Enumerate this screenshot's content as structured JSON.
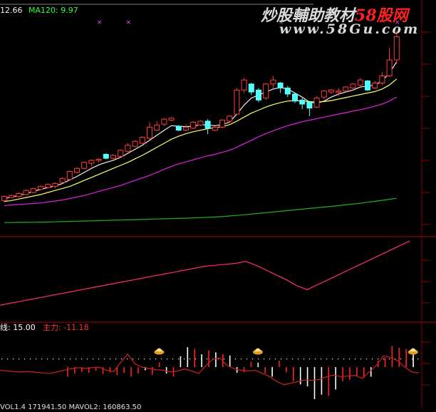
{
  "colors": {
    "background": "#000000",
    "grid": "#8b0000",
    "candle_up": "#ff3b3b",
    "candle_down": "#54ffff",
    "ma_white": "#f0f0f0",
    "ma_yellow": "#ffff66",
    "ma_magenta": "#e020e0",
    "ma_green": "#20b020",
    "indicator_line": "#ff3060",
    "volume_up": "#ff2020",
    "volume_down": "#ffffff",
    "ma120_label": "#30ff30",
    "main_force_label": "#ff3030"
  },
  "header": {
    "ma_partial_value": "12.66",
    "ma120_label": "MA120: 9.97"
  },
  "watermark": {
    "brand_prefix": "炒股輔助教材",
    "brand_highlight": "58股网",
    "url": "www.58Gu.com"
  },
  "lower_panel": {
    "line_label": "线: 15.00",
    "main_force_label": "主力: -11.18"
  },
  "footer": {
    "partial_text": "VOL1.4 171941.50  MAVOL2: 160863.50"
  },
  "chart_data": [
    {
      "type": "candlestick",
      "title": "",
      "candles": [
        [
          5.6,
          6.0,
          5.4,
          6.1
        ],
        [
          5.9,
          6.1,
          5.8,
          6.2
        ],
        [
          6.0,
          6.3,
          5.9,
          6.4
        ],
        [
          6.2,
          6.6,
          6.1,
          6.7
        ],
        [
          6.4,
          6.8,
          6.3,
          6.9
        ],
        [
          6.7,
          7.0,
          6.6,
          7.1
        ],
        [
          6.9,
          7.2,
          6.8,
          7.3
        ],
        [
          7.0,
          7.3,
          6.8,
          7.4
        ],
        [
          7.4,
          7.8,
          7.3,
          7.9
        ],
        [
          7.7,
          8.5,
          7.6,
          8.6
        ],
        [
          8.4,
          8.8,
          8.3,
          8.9
        ],
        [
          8.8,
          9.4,
          8.7,
          9.5
        ],
        [
          9.3,
          9.6,
          9.0,
          9.7
        ],
        [
          9.6,
          9.7,
          9.4,
          9.8
        ],
        [
          10.2,
          9.8,
          9.7,
          10.3
        ],
        [
          9.8,
          10.1,
          9.7,
          10.2
        ],
        [
          10.0,
          10.6,
          9.9,
          10.7
        ],
        [
          10.5,
          11.1,
          10.4,
          11.3
        ],
        [
          11.0,
          11.5,
          10.9,
          11.6
        ],
        [
          11.3,
          11.9,
          11.2,
          12.0
        ],
        [
          11.8,
          12.9,
          11.7,
          13.4
        ],
        [
          12.6,
          13.1,
          12.5,
          13.5
        ],
        [
          13.2,
          13.7,
          13.0,
          13.8
        ],
        [
          13.6,
          13.8,
          13.5,
          13.9
        ],
        [
          13.0,
          12.6,
          12.5,
          13.1
        ],
        [
          12.6,
          12.9,
          12.5,
          13.2
        ],
        [
          12.8,
          13.4,
          12.7,
          13.5
        ],
        [
          13.1,
          13.5,
          13.0,
          13.6
        ],
        [
          13.5,
          12.8,
          12.2,
          13.7
        ],
        [
          12.6,
          12.9,
          12.5,
          13.0
        ],
        [
          12.9,
          13.6,
          12.8,
          13.7
        ],
        [
          13.5,
          14.0,
          13.3,
          14.1
        ],
        [
          14.2,
          16.6,
          14.1,
          16.8
        ],
        [
          16.6,
          17.6,
          16.3,
          17.8
        ],
        [
          17.2,
          16.4,
          16.1,
          17.3
        ],
        [
          16.6,
          15.6,
          15.4,
          16.8
        ],
        [
          15.8,
          17.2,
          15.6,
          17.3
        ],
        [
          17.2,
          17.6,
          16.8,
          18.0
        ],
        [
          17.3,
          16.8,
          16.3,
          17.4
        ],
        [
          16.8,
          16.2,
          15.9,
          17.0
        ],
        [
          16.2,
          15.5,
          15.3,
          16.3
        ],
        [
          15.6,
          15.2,
          14.7,
          15.8
        ],
        [
          15.4,
          14.8,
          14.0,
          15.5
        ],
        [
          14.9,
          15.8,
          14.8,
          16.0
        ],
        [
          15.9,
          16.5,
          15.7,
          16.6
        ],
        [
          16.4,
          16.6,
          16.2,
          16.7
        ],
        [
          16.4,
          16.5,
          16.0,
          16.8
        ],
        [
          16.5,
          16.9,
          16.4,
          17.0
        ],
        [
          16.8,
          17.2,
          16.6,
          17.3
        ],
        [
          17.1,
          17.6,
          16.9,
          17.8
        ],
        [
          17.5,
          16.6,
          16.5,
          17.6
        ],
        [
          16.8,
          17.3,
          16.7,
          17.5
        ],
        [
          17.3,
          18.0,
          17.1,
          18.4
        ],
        [
          18.0,
          19.6,
          17.9,
          20.8
        ],
        [
          19.6,
          21.9,
          19.2,
          22.5
        ]
      ],
      "moving_averages": [
        {
          "name": "",
          "color_key": "ma_white",
          "values": [
            5.8,
            5.95,
            6.1,
            6.3,
            6.5,
            6.7,
            6.9,
            7.05,
            7.3,
            7.65,
            8.0,
            8.4,
            8.8,
            9.15,
            9.4,
            9.6,
            9.9,
            10.3,
            10.7,
            11.1,
            11.6,
            12.1,
            12.6,
            13.05,
            13.0,
            12.95,
            13.0,
            13.15,
            13.1,
            13.05,
            13.15,
            13.4,
            14.2,
            15.1,
            15.8,
            16.1,
            16.4,
            16.7,
            16.85,
            16.7,
            16.3,
            15.9,
            15.4,
            15.3,
            15.5,
            15.9,
            16.2,
            16.4,
            16.6,
            16.9,
            17.0,
            17.1,
            17.5,
            18.3,
            19.4
          ]
        },
        {
          "name": "",
          "color_key": "ma_yellow",
          "values": [
            5.5,
            5.6,
            5.75,
            5.9,
            6.05,
            6.2,
            6.4,
            6.6,
            6.8,
            7.0,
            7.3,
            7.6,
            7.9,
            8.2,
            8.5,
            8.8,
            9.1,
            9.4,
            9.75,
            10.1,
            10.5,
            10.9,
            11.3,
            11.7,
            12.0,
            12.25,
            12.45,
            12.6,
            12.75,
            12.85,
            12.95,
            13.15,
            13.5,
            13.9,
            14.3,
            14.6,
            14.9,
            15.15,
            15.35,
            15.5,
            15.55,
            15.5,
            15.45,
            15.4,
            15.45,
            15.55,
            15.7,
            15.85,
            16.0,
            16.15,
            16.3,
            16.45,
            16.7,
            17.1,
            17.7
          ]
        },
        {
          "name": "",
          "color_key": "ma_magenta",
          "values": [
            5.1,
            5.15,
            5.2,
            5.25,
            5.3,
            5.35,
            5.45,
            5.55,
            5.65,
            5.8,
            5.95,
            6.1,
            6.3,
            6.5,
            6.7,
            6.9,
            7.1,
            7.35,
            7.6,
            7.85,
            8.1,
            8.4,
            8.7,
            9.0,
            9.25,
            9.45,
            9.65,
            9.85,
            10.05,
            10.2,
            10.4,
            10.6,
            10.9,
            11.25,
            11.6,
            11.95,
            12.25,
            12.55,
            12.8,
            13.05,
            13.25,
            13.45,
            13.6,
            13.75,
            13.9,
            14.05,
            14.2,
            14.35,
            14.5,
            14.65,
            14.8,
            15.0,
            15.2,
            15.5,
            15.9
          ]
        },
        {
          "name": "MA120",
          "color_key": "ma_green",
          "values": [
            3.4,
            3.41,
            3.42,
            3.43,
            3.44,
            3.45,
            3.46,
            3.48,
            3.5,
            3.52,
            3.54,
            3.56,
            3.58,
            3.6,
            3.62,
            3.64,
            3.66,
            3.68,
            3.7,
            3.72,
            3.74,
            3.76,
            3.78,
            3.8,
            3.82,
            3.84,
            3.87,
            3.9,
            3.93,
            3.96,
            4.0,
            4.06,
            4.12,
            4.18,
            4.25,
            4.32,
            4.39,
            4.46,
            4.53,
            4.6,
            4.67,
            4.74,
            4.81,
            4.88,
            4.95,
            5.02,
            5.09,
            5.17,
            5.25,
            5.33,
            5.42,
            5.52,
            5.62,
            5.72,
            5.82
          ]
        }
      ],
      "top_markers": [
        13,
        17,
        38,
        54
      ]
    },
    {
      "type": "line",
      "title": "",
      "values": [
        0.1,
        0.14,
        0.18,
        0.22,
        0.26,
        0.3,
        0.34,
        0.38,
        0.42,
        0.46,
        0.5,
        0.54,
        0.58,
        0.62,
        0.66,
        0.7,
        0.74,
        0.78,
        0.82,
        0.86,
        0.9,
        0.92,
        0.94,
        0.96,
        1.0,
        0.92,
        0.82,
        0.72,
        0.62,
        0.5,
        0.42,
        0.52,
        0.62,
        0.72,
        0.82,
        0.92,
        1.02,
        1.12,
        1.22,
        1.32,
        1.42
      ]
    },
    {
      "type": "bar",
      "title": "",
      "bars": [
        [
          -0.3,
          1
        ],
        [
          -0.2,
          1
        ],
        [
          -0.15,
          1
        ],
        [
          -0.18,
          1
        ],
        [
          -0.12,
          1
        ],
        [
          -0.22,
          1
        ],
        [
          -0.16,
          1
        ],
        [
          -0.25,
          1
        ],
        [
          -0.18,
          1
        ],
        [
          -0.3,
          1
        ],
        [
          -0.2,
          1
        ],
        [
          -0.1,
          0
        ],
        [
          -0.24,
          1
        ],
        [
          0.14,
          1
        ],
        [
          -0.2,
          0
        ],
        [
          -0.3,
          1
        ],
        [
          0.34,
          0
        ],
        [
          0.62,
          0
        ],
        [
          0.56,
          1
        ],
        [
          0.4,
          0
        ],
        [
          0.52,
          1
        ],
        [
          0.46,
          0
        ],
        [
          0.4,
          1
        ],
        [
          0.36,
          0
        ],
        [
          -0.18,
          0
        ],
        [
          -0.16,
          1
        ],
        [
          0.16,
          1
        ],
        [
          0.14,
          0
        ],
        [
          -0.2,
          1
        ],
        [
          -0.3,
          0
        ],
        [
          0.2,
          1
        ],
        [
          -0.16,
          1
        ],
        [
          -0.44,
          1
        ],
        [
          -0.54,
          0
        ],
        [
          -0.6,
          0
        ],
        [
          -1.0,
          0
        ],
        [
          -0.86,
          0
        ],
        [
          -0.9,
          1
        ],
        [
          -0.7,
          0
        ],
        [
          -0.44,
          1
        ],
        [
          -0.4,
          1
        ],
        [
          -0.3,
          1
        ],
        [
          -0.34,
          1
        ],
        [
          -0.3,
          0
        ],
        [
          0.2,
          1
        ],
        [
          0.3,
          1
        ],
        [
          0.66,
          1
        ],
        [
          0.6,
          1
        ],
        [
          0.56,
          1
        ],
        [
          0.52,
          0
        ]
      ],
      "line": [
        -0.1,
        -0.12,
        -0.14,
        -0.15,
        -0.14,
        -0.16,
        -0.18,
        -0.2,
        -0.15,
        -0.1,
        -0.05,
        -0.02,
        -0.04,
        -0.02,
        0.0,
        -0.1,
        -0.14,
        0.15,
        0.4,
        0.1,
        0.0,
        -0.05,
        -0.08,
        -0.1,
        -0.15,
        -0.12,
        -0.06,
        -0.12,
        -0.2,
        0.05,
        0.25,
        0.28,
        0.05,
        -0.05,
        -0.1,
        -0.12,
        -0.1,
        -0.2,
        -0.3,
        -0.45,
        -0.55,
        -0.5,
        -0.45,
        -0.4,
        -0.42,
        -0.38,
        -0.3,
        -0.25,
        -0.3,
        -0.28,
        -0.26,
        -0.35,
        -0.15,
        0.05,
        0.35,
        0.3,
        0.2,
        0.0,
        -0.15,
        -0.18
      ],
      "dotted_level": 0.22,
      "signal_markers": [
        16,
        30,
        52
      ]
    }
  ]
}
